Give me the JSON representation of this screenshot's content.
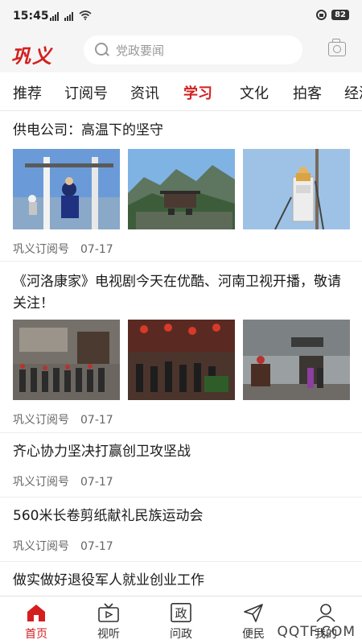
{
  "status_bar": {
    "time": "15:45",
    "battery": "82"
  },
  "header": {
    "logo": "巩义",
    "search_placeholder": "党政要闻"
  },
  "tabs": [
    {
      "label": "推荐"
    },
    {
      "label": "订阅号"
    },
    {
      "label": "资讯"
    },
    {
      "label": "学习",
      "active": true
    },
    {
      "label": "文化"
    },
    {
      "label": "拍客"
    },
    {
      "label": "经济"
    }
  ],
  "articles": [
    {
      "title": "供电公司：高温下的坚守",
      "source": "巩义订阅号",
      "date": "07-17"
    },
    {
      "title": "《河洛康家》电视剧今天在优酷、河南卫视开播，敬请关注！",
      "source": "巩义订阅号",
      "date": "07-17"
    },
    {
      "title": "齐心协力坚决打赢创卫攻坚战",
      "source": "巩义订阅号",
      "date": "07-17"
    },
    {
      "title": "560米长卷剪纸献礼民族运动会",
      "source": "巩义订阅号",
      "date": "07-17"
    },
    {
      "title": "做实做好退役军人就业创业工作"
    }
  ],
  "bottom_nav": [
    {
      "label": "首页",
      "icon": "home-icon",
      "active": true
    },
    {
      "label": "视听",
      "icon": "tv-icon"
    },
    {
      "label": "问政",
      "icon": "wenzheng-icon",
      "glyph": "政"
    },
    {
      "label": "便民",
      "icon": "send-icon"
    },
    {
      "label": "我的",
      "icon": "user-icon"
    }
  ],
  "watermark": "QQTF.COM",
  "colors": {
    "accent": "#d41f1f",
    "background": "#f5f5f5"
  }
}
